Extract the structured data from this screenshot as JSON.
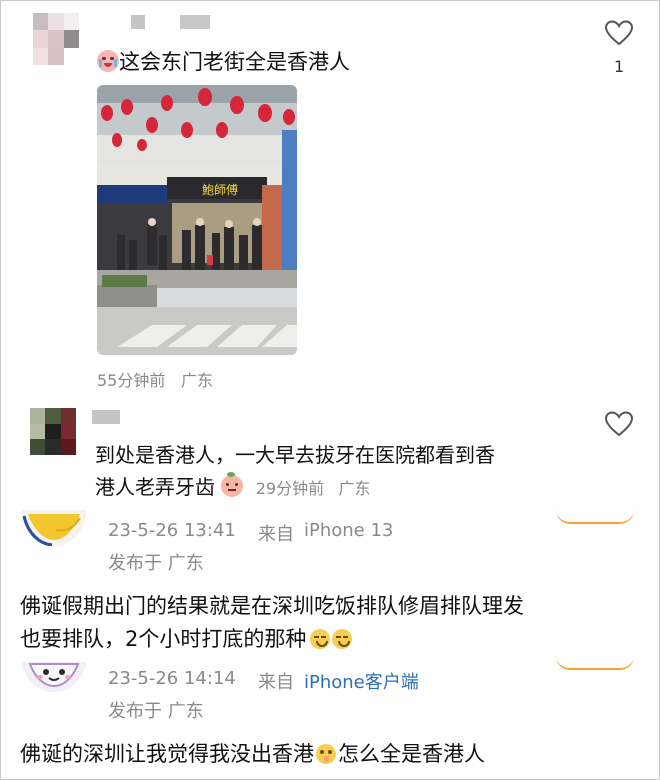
{
  "post1": {
    "text": "这会东门老街全是香港人",
    "time": "55分钟前",
    "location": "广东",
    "like_count": "1",
    "photo_sign": "鮑師傅"
  },
  "post2": {
    "text_line1": "到处是香港人，一大早去拔牙在医院都看到香",
    "text_line2": "港人老弄牙齿",
    "time": "29分钟前",
    "location": "广东"
  },
  "post3": {
    "date": "23-5-26 13:41",
    "from": "来自",
    "device": "iPhone 13",
    "published": "发布于 广东",
    "text_line1": "佛诞假期出门的结果就是在深圳吃饭排队修眉排队理发",
    "text_line2": "也要排队，2个小时打底的那种"
  },
  "post4": {
    "date": "23-5-26 14:14",
    "from": "来自",
    "device": "iPhone客户端",
    "published": "发布于 广东",
    "text_a": "佛诞的深圳让我觉得我没出香港",
    "text_b": "怎么全是香港人"
  },
  "colors": {
    "accent_orange": "#f2a33a",
    "link_blue": "#2f6fb5",
    "meta_gray": "#8a8a8a"
  }
}
